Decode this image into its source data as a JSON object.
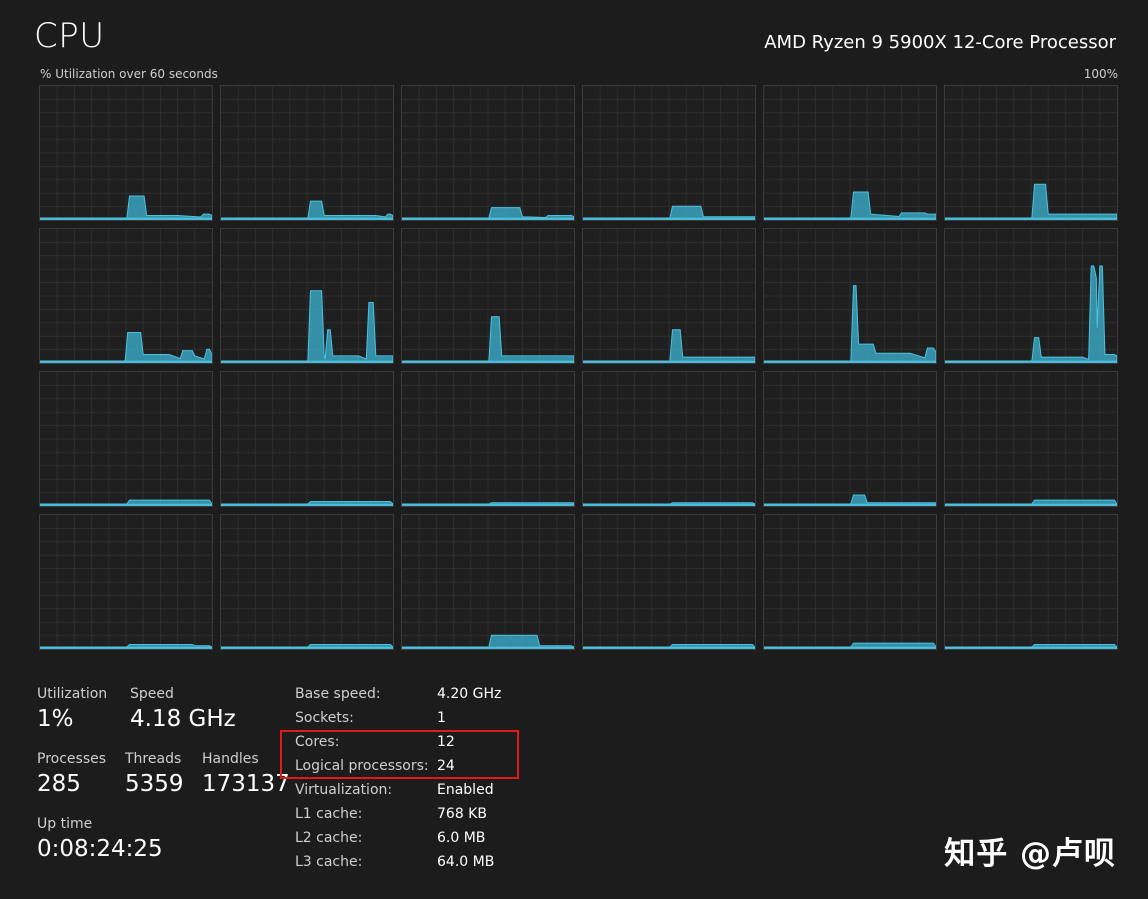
{
  "header": {
    "title": "CPU",
    "processor_name": "AMD Ryzen 9 5900X 12-Core Processor",
    "utilization_caption": "% Utilization over 60 seconds",
    "max_label": "100%"
  },
  "colors": {
    "background": "#1c1c1c",
    "graph_line": "#4cc2e0",
    "graph_fill": "#3aa4bf",
    "grid": "#2e2e2e",
    "highlight": "#e11919"
  },
  "graph_peaks": [
    [
      [
        52,
        0.17
      ],
      [
        62,
        0.02
      ],
      [
        80,
        0.02
      ],
      [
        95,
        0.03
      ],
      [
        100,
        0.02
      ]
    ],
    [
      [
        52,
        0.13
      ],
      [
        60,
        0.02
      ],
      [
        90,
        0.02
      ],
      [
        97,
        0.03
      ],
      [
        100,
        0.02
      ]
    ],
    [
      [
        52,
        0.08
      ],
      [
        70,
        0.01
      ],
      [
        85,
        0.02
      ],
      [
        100,
        0.01
      ]
    ],
    [
      [
        52,
        0.09
      ],
      [
        70,
        0.01
      ],
      [
        100,
        0.01
      ]
    ],
    [
      [
        52,
        0.2
      ],
      [
        62,
        0.03
      ],
      [
        80,
        0.04
      ],
      [
        95,
        0.03
      ],
      [
        100,
        0.03
      ]
    ],
    [
      [
        52,
        0.26
      ],
      [
        60,
        0.03
      ],
      [
        85,
        0.03
      ],
      [
        100,
        0.03
      ]
    ],
    [
      [
        51,
        0.22
      ],
      [
        55,
        0.22
      ],
      [
        60,
        0.05
      ],
      [
        75,
        0.05
      ],
      [
        83,
        0.08
      ],
      [
        90,
        0.04
      ],
      [
        97,
        0.09
      ],
      [
        100,
        0.05
      ]
    ],
    [
      [
        52,
        0.54
      ],
      [
        60,
        0.04
      ],
      [
        62,
        0.24
      ],
      [
        65,
        0.04
      ],
      [
        80,
        0.04
      ],
      [
        86,
        0.45
      ],
      [
        90,
        0.04
      ],
      [
        100,
        0.04
      ]
    ],
    [
      [
        52,
        0.34
      ],
      [
        58,
        0.04
      ],
      [
        80,
        0.04
      ],
      [
        100,
        0.04
      ]
    ],
    [
      [
        52,
        0.24
      ],
      [
        58,
        0.03
      ],
      [
        80,
        0.03
      ],
      [
        100,
        0.03
      ]
    ],
    [
      [
        52,
        0.58
      ],
      [
        55,
        0.13
      ],
      [
        65,
        0.06
      ],
      [
        85,
        0.06
      ],
      [
        95,
        0.1
      ],
      [
        100,
        0.07
      ]
    ],
    [
      [
        52,
        0.18
      ],
      [
        56,
        0.03
      ],
      [
        80,
        0.03
      ],
      [
        85,
        0.73
      ],
      [
        88,
        0.64
      ],
      [
        90,
        0.73
      ],
      [
        93,
        0.05
      ],
      [
        100,
        0.04
      ]
    ],
    [
      [
        52,
        0.03
      ],
      [
        100,
        0.0
      ]
    ],
    [
      [
        52,
        0.02
      ],
      [
        100,
        0.0
      ]
    ],
    [
      [
        52,
        0.01
      ],
      [
        100,
        0.01
      ]
    ],
    [
      [
        52,
        0.01
      ],
      [
        100,
        0.0
      ]
    ],
    [
      [
        52,
        0.07
      ],
      [
        60,
        0.01
      ],
      [
        100,
        0.01
      ]
    ],
    [
      [
        52,
        0.03
      ],
      [
        100,
        0.0
      ]
    ],
    [
      [
        52,
        0.02
      ],
      [
        90,
        0.01
      ],
      [
        100,
        0.0
      ]
    ],
    [
      [
        52,
        0.02
      ],
      [
        100,
        0.0
      ]
    ],
    [
      [
        52,
        0.09
      ],
      [
        80,
        0.01
      ],
      [
        100,
        0.0
      ]
    ],
    [
      [
        52,
        0.02
      ],
      [
        100,
        0.0
      ]
    ],
    [
      [
        52,
        0.03
      ],
      [
        100,
        0.0
      ]
    ],
    [
      [
        52,
        0.02
      ],
      [
        100,
        0.0
      ]
    ]
  ],
  "stats": {
    "utilization": {
      "label": "Utilization",
      "value": "1%"
    },
    "speed": {
      "label": "Speed",
      "value": "4.18 GHz"
    },
    "processes": {
      "label": "Processes",
      "value": "285"
    },
    "threads": {
      "label": "Threads",
      "value": "5359"
    },
    "handles": {
      "label": "Handles",
      "value": "173137"
    },
    "uptime": {
      "label": "Up time",
      "value": "0:08:24:25"
    }
  },
  "specs": [
    {
      "key": "Base speed:",
      "value": "4.20 GHz"
    },
    {
      "key": "Sockets:",
      "value": "1"
    },
    {
      "key": "Cores:",
      "value": "12"
    },
    {
      "key": "Logical processors:",
      "value": "24"
    },
    {
      "key": "Virtualization:",
      "value": "Enabled"
    },
    {
      "key": "L1 cache:",
      "value": "768 KB"
    },
    {
      "key": "L2 cache:",
      "value": "6.0 MB"
    },
    {
      "key": "L3 cache:",
      "value": "64.0 MB"
    }
  ],
  "watermark": "知乎 @卢呗"
}
